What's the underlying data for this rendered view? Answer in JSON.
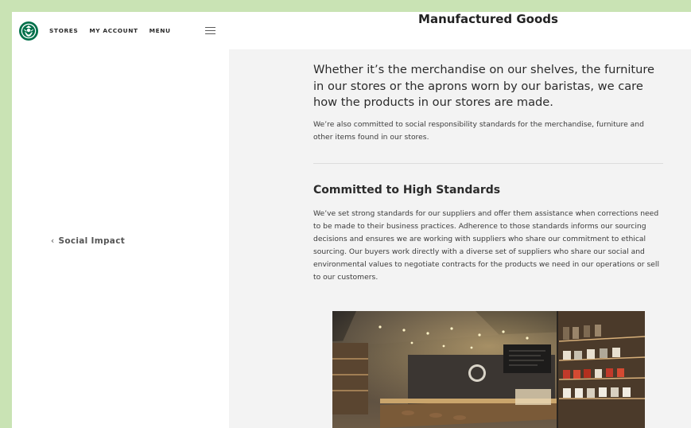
{
  "nav": {
    "stores": "STORES",
    "my_account": "MY ACCOUNT",
    "menu": "MENU"
  },
  "sidebar": {
    "back_link": "Social Impact"
  },
  "page": {
    "title": "Manufactured Goods",
    "lead": "Whether it’s the merchandise on our shelves, the furniture in our stores or the aprons worn by our baristas, we care how the products in our stores are made.",
    "intro": "We’re also committed to social responsibility standards for the merchandise, furniture and other items found in our stores.",
    "section_heading": "Committed to High Standards",
    "section_body": "We’ve set strong standards for our suppliers and offer them assistance when corrections need to be made to their business practices. Adherence to those standards informs our sourcing decisions and ensures we are working with suppliers who share our commitment to ethical sourcing. Our buyers work directly with a diverse set of suppliers who share our social and environmental values to negotiate contracts for the products we need in our operations or sell to our customers."
  },
  "colors": {
    "page_bg": "#c9e3b4",
    "content_bg": "#f3f3f3",
    "brand_green": "#00704a"
  },
  "icons": {
    "logo": "starbucks-siren-logo",
    "menu": "hamburger-icon",
    "back": "chevron-left-icon"
  }
}
